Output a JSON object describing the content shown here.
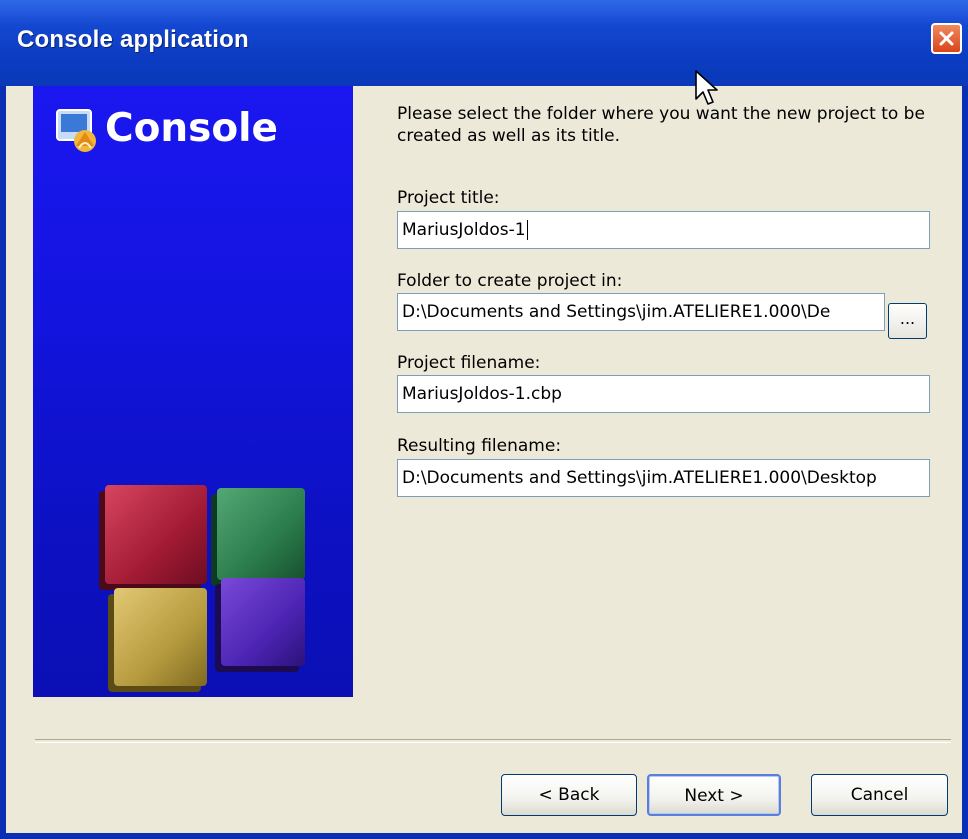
{
  "window": {
    "title": "Console application"
  },
  "banner": {
    "title": "Console"
  },
  "intro_text": "Please select the folder where you want the new project to be created as well as its title.",
  "fields": {
    "project_title": {
      "label": "Project title:",
      "value": "MariusJoldos-1"
    },
    "folder": {
      "label": "Folder to create project in:",
      "value": "D:\\Documents and Settings\\jim.ATELIERE1.000\\De",
      "browse_label": "..."
    },
    "project_filename": {
      "label": "Project filename:",
      "value": "MariusJoldos-1.cbp"
    },
    "resulting_filename": {
      "label": "Resulting filename:",
      "value": "D:\\Documents and Settings\\jim.ATELIERE1.000\\Desktop"
    }
  },
  "buttons": {
    "back": "< Back",
    "next": "Next >",
    "cancel": "Cancel"
  }
}
